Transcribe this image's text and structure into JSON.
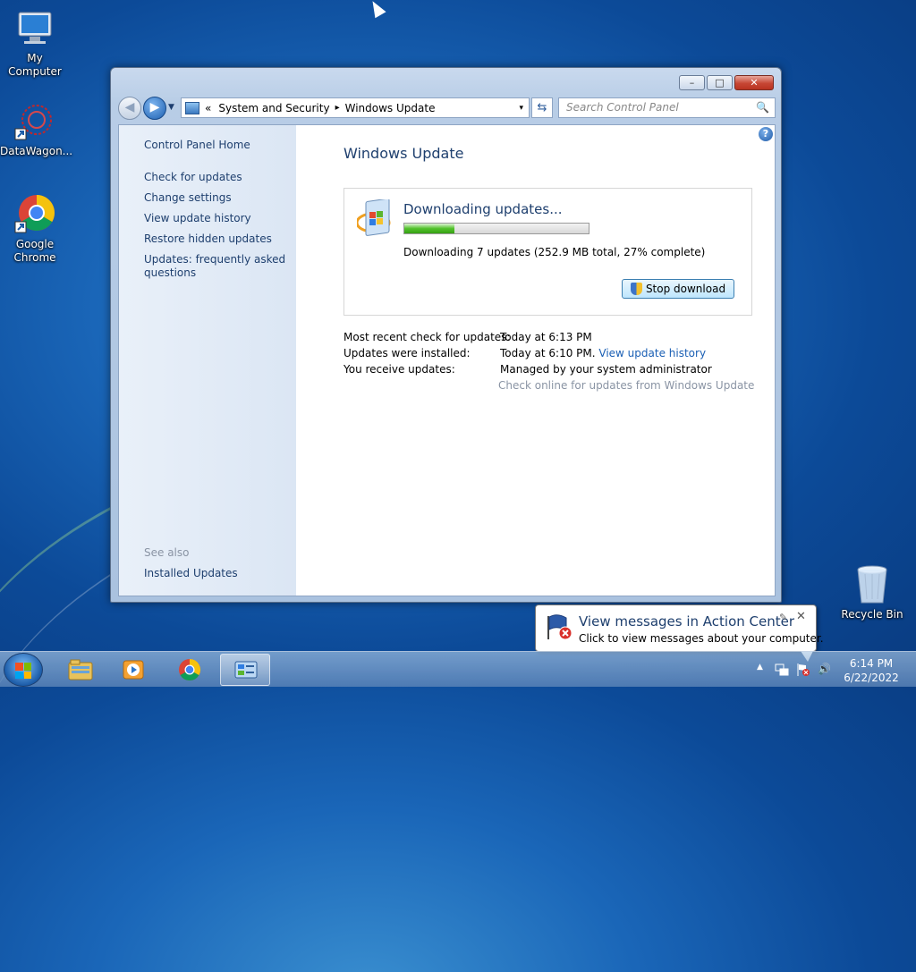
{
  "desktop": {
    "icons": [
      {
        "label": "My Computer",
        "icon": "computer-icon"
      },
      {
        "label": "DataWagon...",
        "icon": "datawagon-icon"
      },
      {
        "label": "Google Chrome",
        "icon": "chrome-icon"
      },
      {
        "label": "Recycle Bin",
        "icon": "recycle-bin-icon"
      }
    ]
  },
  "window": {
    "controls": {
      "minimize": "–",
      "maximize": "□",
      "close": "✕"
    },
    "address": {
      "overflow": "«",
      "crumbs": [
        "System and Security",
        "Windows Update"
      ],
      "separator": "▸",
      "dropdown": "▾"
    },
    "search": {
      "placeholder": "Search Control Panel",
      "icon": "🔍"
    },
    "refresh": "⇆",
    "sidebar": {
      "home": "Control Panel Home",
      "links": [
        "Check for updates",
        "Change settings",
        "View update history",
        "Restore hidden updates",
        "Updates: frequently asked",
        "questions"
      ],
      "see_also": "See also",
      "installed_updates": "Installed Updates"
    },
    "help": "?",
    "main": {
      "title": "Windows Update",
      "status": {
        "heading": "Downloading updates...",
        "progress_percent": 27,
        "details": "Downloading 7 updates (252.9 MB total, 27% complete)",
        "stop_button": "Stop download"
      },
      "info": [
        {
          "key": "Most recent check for updates:",
          "value": "Today at 6:13 PM"
        },
        {
          "key": "Updates were installed:",
          "value": "Today at 6:10 PM.",
          "link": "View update history"
        },
        {
          "key": "You receive updates:",
          "value": "Managed by your system administrator"
        }
      ],
      "check_online": "Check online for updates from Windows Update"
    }
  },
  "notification": {
    "title": "View messages in Action Center",
    "message": "Click to view messages about your computer.",
    "close": "✕",
    "pin": "✎"
  },
  "taskbar": {
    "clock_time": "6:14 PM",
    "clock_date": "6/22/2022",
    "tray_up": "▲",
    "volume": "🔊"
  }
}
